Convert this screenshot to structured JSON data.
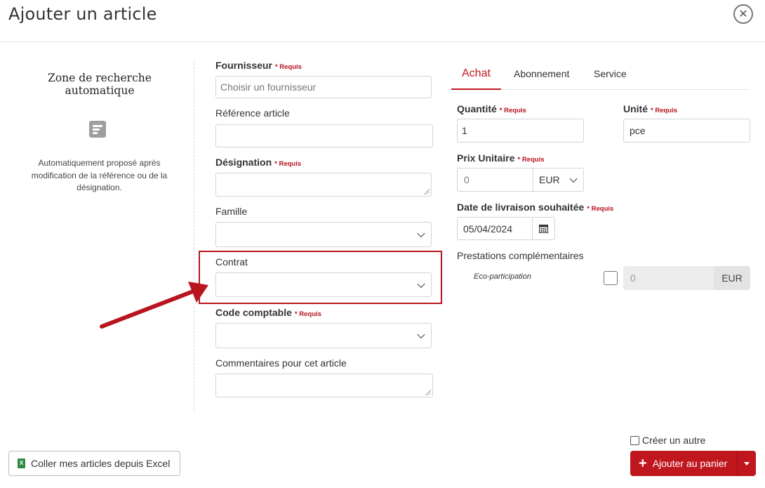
{
  "header": {
    "title": "Ajouter un article",
    "close_icon": "close-icon"
  },
  "left_panel": {
    "title": "Zone de recherche automatique",
    "icon": "document-lines-icon",
    "description": "Automatiquement proposé après modification de la référence ou de la désignation."
  },
  "required_label": "* Requis",
  "form": {
    "fournisseur": {
      "label": "Fournisseur",
      "placeholder": "Choisir un fournisseur",
      "required": true
    },
    "reference": {
      "label": "Référence article",
      "value": ""
    },
    "designation": {
      "label": "Désignation",
      "value": "",
      "required": true
    },
    "famille": {
      "label": "Famille",
      "value": ""
    },
    "contrat": {
      "label": "Contrat",
      "value": ""
    },
    "code_comptable": {
      "label": "Code comptable",
      "value": "",
      "required": true
    },
    "commentaires": {
      "label": "Commentaires pour cet article",
      "value": ""
    }
  },
  "tabs": [
    {
      "label": "Achat",
      "active": true
    },
    {
      "label": "Abonnement",
      "active": false
    },
    {
      "label": "Service",
      "active": false
    }
  ],
  "achat": {
    "quantite": {
      "label": "Quantité",
      "value": "1",
      "required": true
    },
    "unite": {
      "label": "Unité",
      "value": "pce",
      "required": true
    },
    "prix_unitaire": {
      "label": "Prix Unitaire",
      "placeholder": "0",
      "currency": "EUR",
      "required": true
    },
    "date_livraison": {
      "label": "Date de livraison souhaitée",
      "value": "05/04/2024",
      "required": true,
      "icon": "calendar-icon"
    },
    "prestations": {
      "label": "Prestations complémentaires",
      "eco_label": "Eco-participation",
      "eco_checked": false,
      "eco_placeholder": "0",
      "eco_currency": "EUR"
    }
  },
  "footer": {
    "excel_button": "Coller mes articles depuis Excel",
    "creer_autre_label": "Créer un autre",
    "creer_autre_checked": false,
    "add_button": "Ajouter au panier"
  },
  "colors": {
    "accent": "#c0171f",
    "highlight": "#b8151f"
  }
}
